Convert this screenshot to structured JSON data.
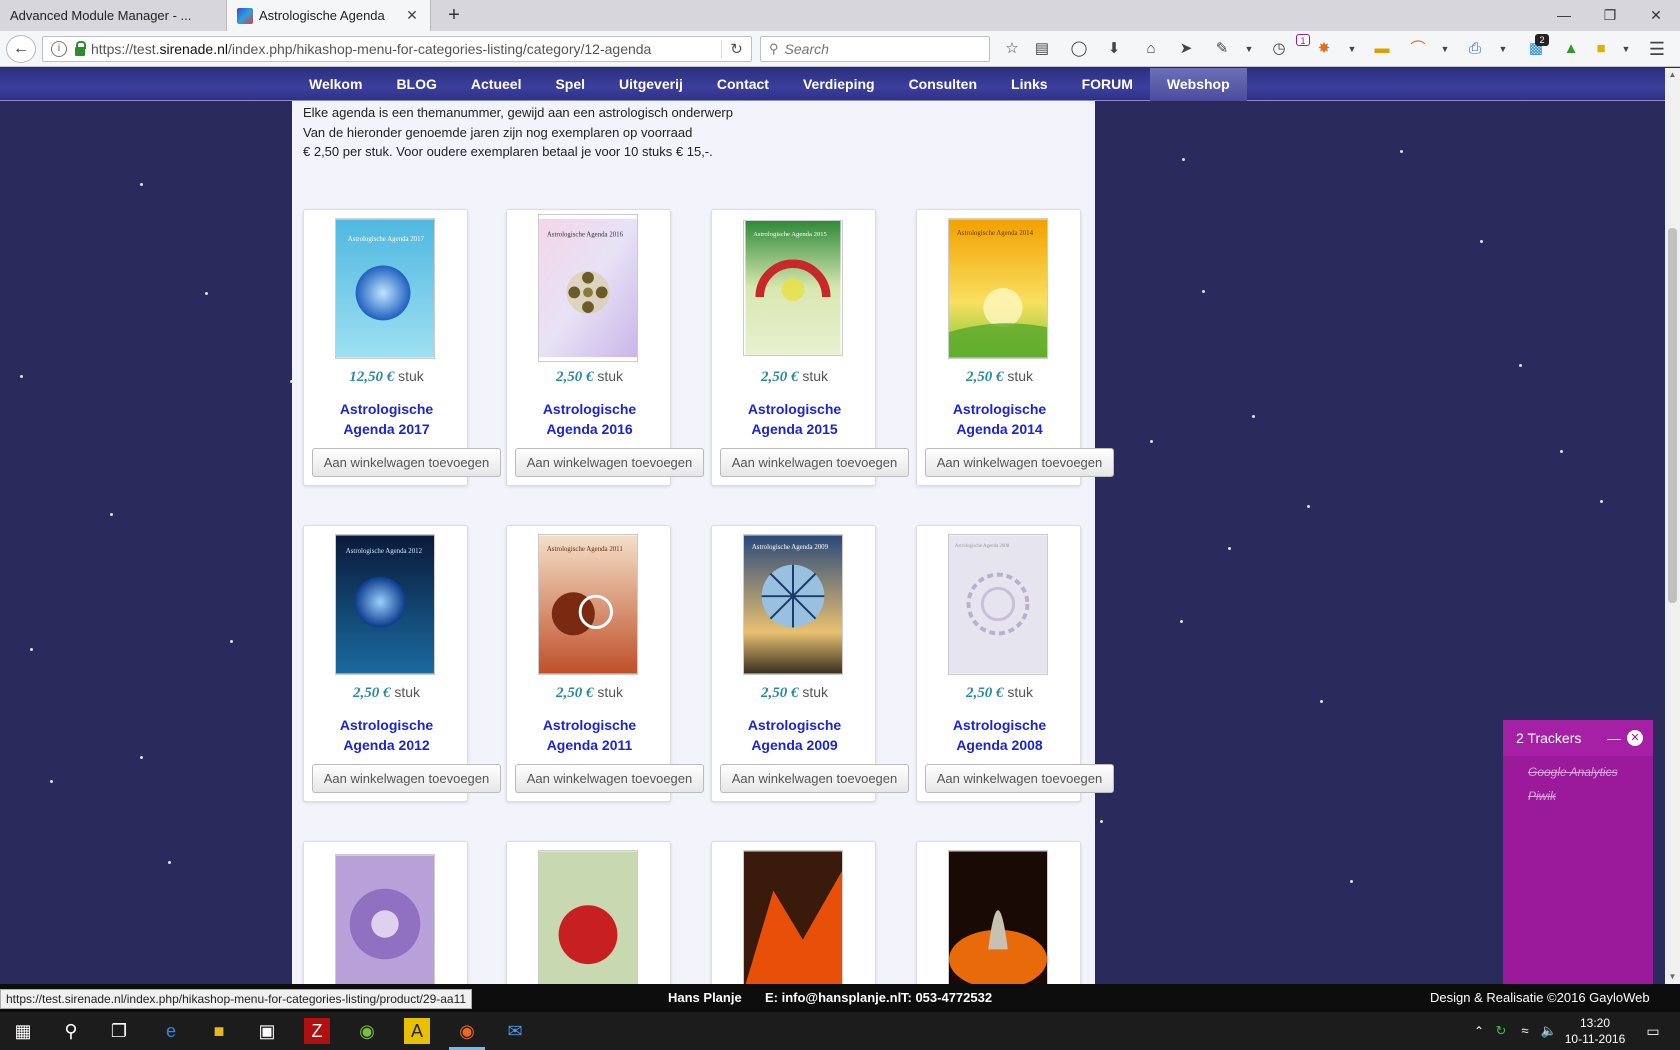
{
  "browser": {
    "tabs": [
      {
        "label": "Advanced Module Manager - ...",
        "close": "✕"
      },
      {
        "label": "Astrologische Agenda",
        "close": "✕"
      }
    ],
    "new_tab": "+",
    "window_controls": {
      "minimize": "—",
      "restore": "❐",
      "close": "✕"
    },
    "url_prefix": "https://test.",
    "url_host": "sirenade.nl",
    "url_path": "/index.php/hikashop-menu-for-categories-listing/category/12-agenda",
    "search_placeholder": "Search",
    "badges": {
      "notifications": "1",
      "extensions": "2"
    }
  },
  "site_menu": {
    "items": [
      "Welkom",
      "BLOG",
      "Actueel",
      "Spel",
      "Uitgeverij",
      "Contact",
      "Verdieping",
      "Consulten",
      "Links",
      "FORUM",
      "Webshop"
    ],
    "active": "Webshop"
  },
  "intro": {
    "line1": "Elke agenda is een themanummer, gewijd aan een astrologisch onderwerp",
    "line2": "Van de hieronder genoemde jaren zijn nog exemplaren op voorraad",
    "line3": "€ 2,50 per stuk. Voor oudere exemplaren betaal je voor 10 stuks € 15,-."
  },
  "products": [
    {
      "price": "12,50 €",
      "unit": "stuk",
      "name1": "Astrologische",
      "name2": "Agenda 2017",
      "button": "Aan winkelwagen toevoegen"
    },
    {
      "price": "2,50 €",
      "unit": "stuk",
      "name1": "Astrologische",
      "name2": "Agenda 2016",
      "button": "Aan winkelwagen toevoegen"
    },
    {
      "price": "2,50 €",
      "unit": "stuk",
      "name1": "Astrologische",
      "name2": "Agenda 2015",
      "button": "Aan winkelwagen toevoegen"
    },
    {
      "price": "2,50 €",
      "unit": "stuk",
      "name1": "Astrologische",
      "name2": "Agenda 2014",
      "button": "Aan winkelwagen toevoegen"
    },
    {
      "price": "2,50 €",
      "unit": "stuk",
      "name1": "Astrologische",
      "name2": "Agenda 2012",
      "button": "Aan winkelwagen toevoegen"
    },
    {
      "price": "2,50 €",
      "unit": "stuk",
      "name1": "Astrologische",
      "name2": "Agenda 2011",
      "button": "Aan winkelwagen toevoegen"
    },
    {
      "price": "2,50 €",
      "unit": "stuk",
      "name1": "Astrologische",
      "name2": "Agenda 2009",
      "button": "Aan winkelwagen toevoegen"
    },
    {
      "price": "2,50 €",
      "unit": "stuk",
      "name1": "Astrologische",
      "name2": "Agenda 2008",
      "button": "Aan winkelwagen toevoegen"
    }
  ],
  "covers": {
    "c2017": "Astrologische Agenda 2017",
    "c2016": "Astrologische Agenda 2016",
    "c2015": "Astrologische Agenda 2015",
    "c2014": "Astrologische Agenda 2014",
    "c2012": "Astrologische Agenda 2012",
    "c2011": "Astrologische Agenda 2011",
    "c2009": "Astrologische Agenda 2009",
    "c2008": "Astrologische Agenda 2008"
  },
  "status_url": "https://test.sirenade.nl/index.php/hikashop-menu-for-categories-listing/product/29-aa11",
  "footer": {
    "name": "Hans Planje",
    "email": "E: info@hansplanje.nl",
    "phone": "T: 053-4772532",
    "credit": "Design & Realisatie ©2016 GayloWeb"
  },
  "trackers": {
    "title": "2 Trackers",
    "minimize": "—",
    "close": "✕",
    "items": [
      "Google Analytics",
      "Piwik"
    ]
  },
  "clock": {
    "time": "13:20",
    "date": "10-11-2016"
  },
  "colors": {
    "accent_purple": "#9b1a9b",
    "link_blue": "#1b24d8",
    "price_teal": "#2a8aa0",
    "background_night": "#2b2a5c"
  }
}
